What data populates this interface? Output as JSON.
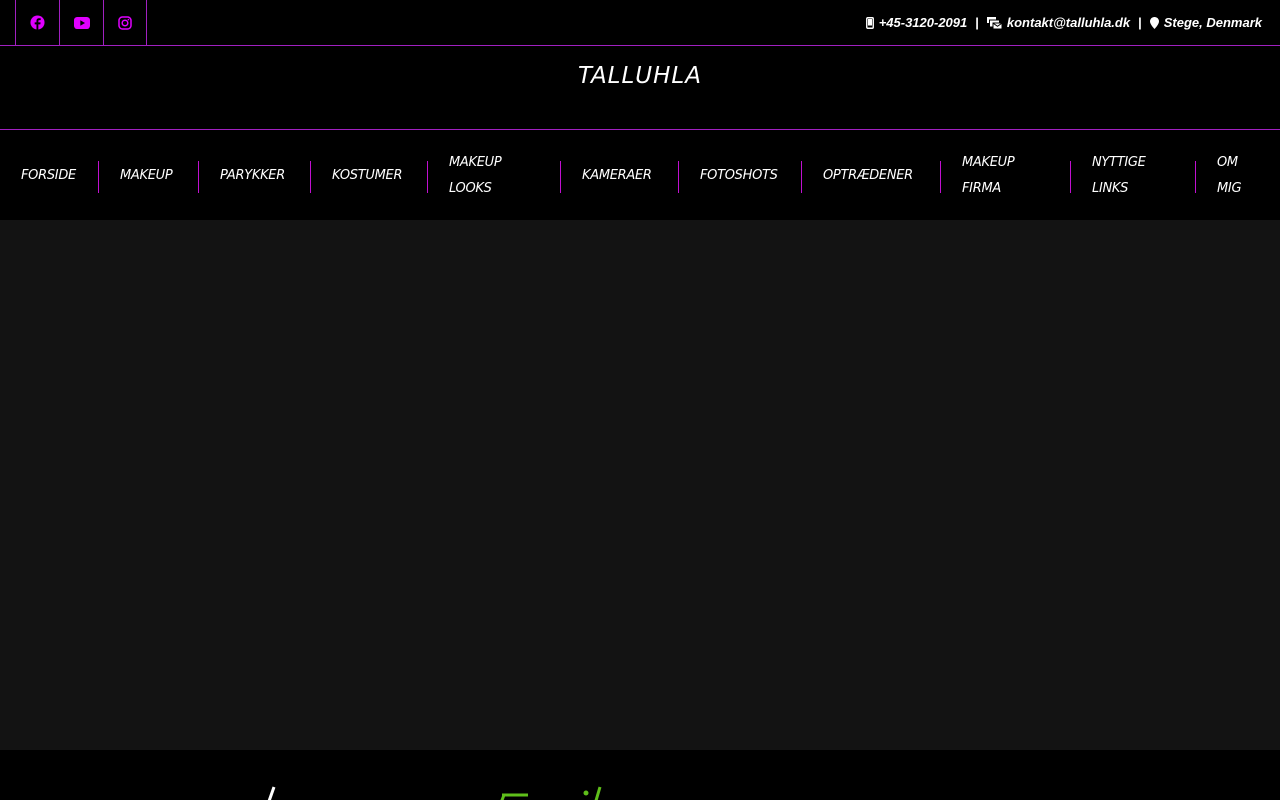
{
  "social": {
    "items": [
      {
        "name": "facebook-icon",
        "color": "#e000ff"
      },
      {
        "name": "youtube-icon",
        "color": "#e000ff"
      },
      {
        "name": "instagram-icon",
        "color": "#e000ff"
      }
    ]
  },
  "contact": {
    "phone": "+45-3120-2091",
    "separator": "|",
    "email": "kontakt@talluhla.dk",
    "location": "Stege, Denmark"
  },
  "brand": {
    "title": "TALLUHLA"
  },
  "nav": {
    "items": [
      {
        "label_line1": "FORSIDE",
        "label_line2": ""
      },
      {
        "label_line1": "MAKEUP",
        "label_line2": ""
      },
      {
        "label_line1": "PARYKKER",
        "label_line2": ""
      },
      {
        "label_line1": "KOSTUMER",
        "label_line2": ""
      },
      {
        "label_line1": "MAKEUP",
        "label_line2": "LOOKS"
      },
      {
        "label_line1": "KAMERAER",
        "label_line2": ""
      },
      {
        "label_line1": "FOTOSHOTS",
        "label_line2": ""
      },
      {
        "label_line1": "OPTRÆDENER",
        "label_line2": ""
      },
      {
        "label_line1": "MAKEUP",
        "label_line2": "FIRMA"
      },
      {
        "label_line1": "NYTTIGE",
        "label_line2": "LINKS"
      },
      {
        "label_line1": "OM",
        "label_line2": "MIG"
      }
    ]
  },
  "colors": {
    "accent": "#a020c0",
    "icon": "#e000ff",
    "hero_bg": "#131313",
    "heading_accent": "#5fbf1a"
  }
}
